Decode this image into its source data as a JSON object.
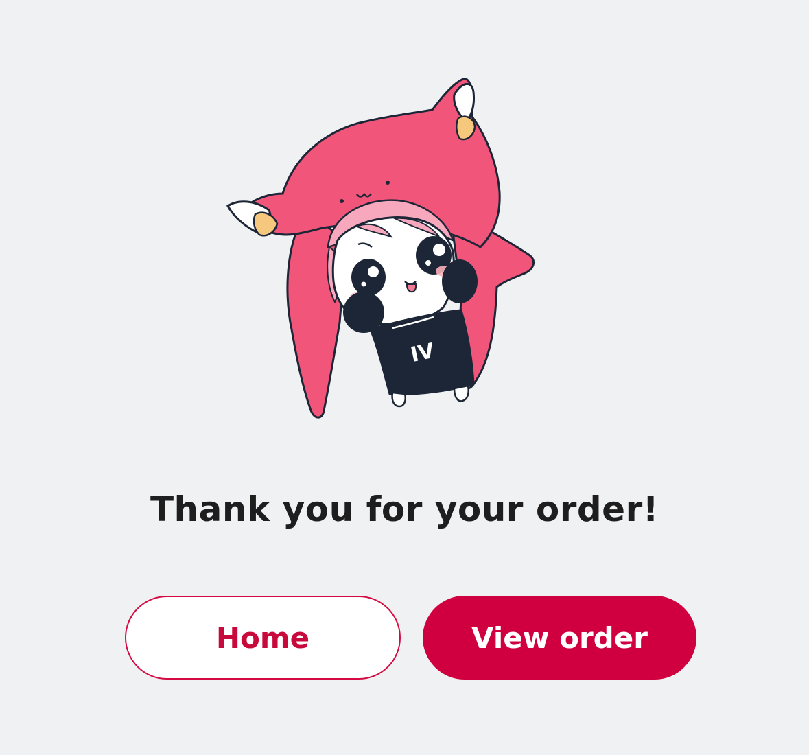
{
  "mascot": {
    "icon": "hooded-mascot-illustration",
    "shirt_mark": "IV",
    "colors": {
      "hood": "#f2557a",
      "hair": "#f7a8bd",
      "shirt": "#1c2636",
      "ear_inner": "#f5c87e"
    }
  },
  "message": {
    "title": "Thank you for your order!"
  },
  "actions": {
    "home_label": "Home",
    "view_order_label": "View order"
  },
  "colors": {
    "background": "#f0f1f3",
    "accent": "#d00040",
    "text": "#1e1e1e"
  }
}
